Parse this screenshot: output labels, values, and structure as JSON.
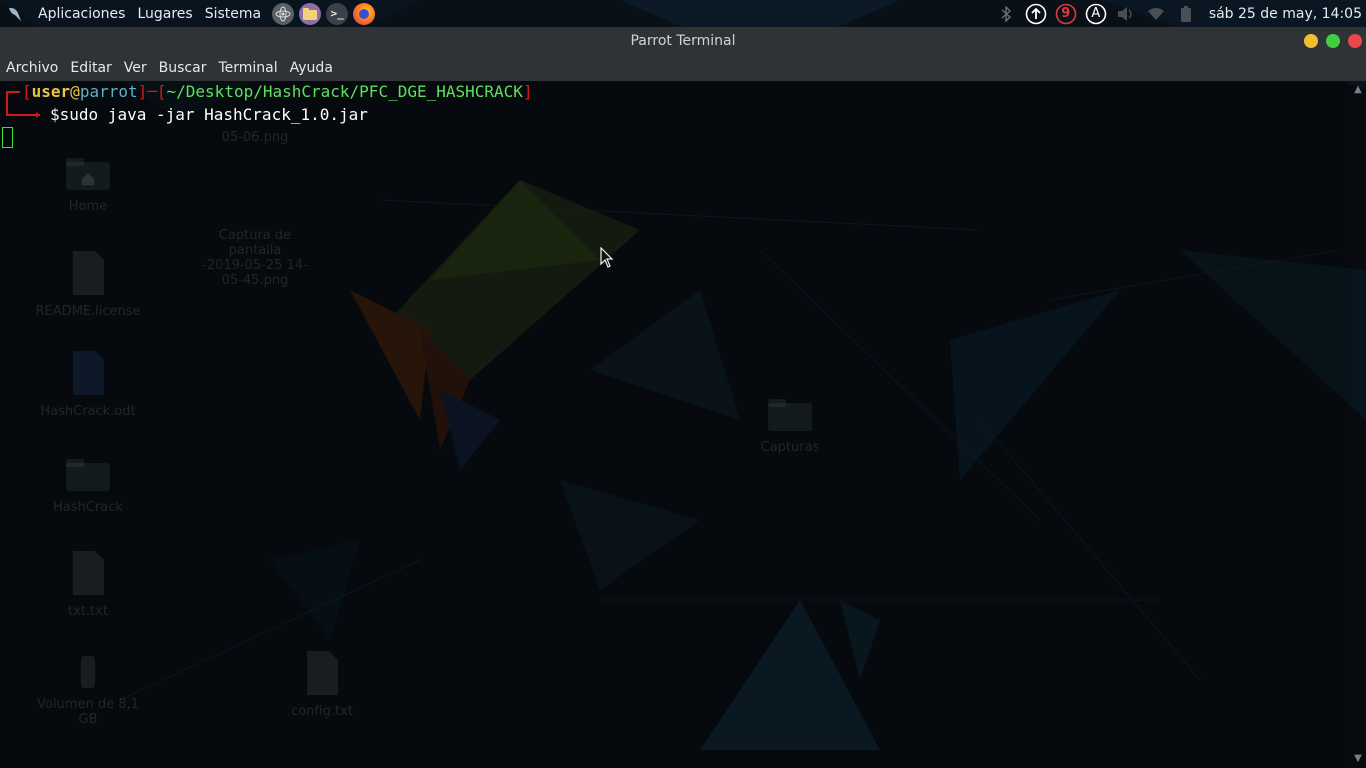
{
  "top_panel": {
    "menus": [
      "Aplicaciones",
      "Lugares",
      "Sistema"
    ],
    "launchers": [
      "atom-icon",
      "folder-icon",
      "terminal-icon",
      "firefox-icon"
    ],
    "tray": {
      "bluetooth_icon": "bluetooth-icon",
      "updates_icon": "arrow-up-circle-icon",
      "notifications_count": "9",
      "accessibility_label": "A",
      "clock": "sáb 25 de may, 14:05"
    }
  },
  "window": {
    "title": "Parrot Terminal",
    "menu": [
      "Archivo",
      "Editar",
      "Ver",
      "Buscar",
      "Terminal",
      "Ayuda"
    ]
  },
  "terminal": {
    "prompt": {
      "user": "user",
      "at": "@",
      "host": "parrot",
      "cwd": "~/Desktop/HashCrack/PFC_DGE_HASHCRACK",
      "symbol": "$"
    },
    "command": "sudo java -jar HashCrack_1.0.jar"
  },
  "desktop_icons": [
    {
      "label": "05-06.png",
      "icon": "image-icon"
    },
    {
      "label": "Home",
      "icon": "home-folder-icon"
    },
    {
      "label": "Captura de pantalla\n-2019-05-25 14-\n05-45.png",
      "icon": "image-icon"
    },
    {
      "label": "README.license",
      "icon": "text-file-icon"
    },
    {
      "label": "HashCrack.odt",
      "icon": "document-icon"
    },
    {
      "label": "HashCrack",
      "icon": "folder-icon"
    },
    {
      "label": "Capturas",
      "icon": "folder-icon"
    },
    {
      "label": "txt.txt",
      "icon": "text-file-icon"
    },
    {
      "label": "Volumen de 8,1 GB",
      "icon": "usb-drive-icon"
    },
    {
      "label": "config.txt",
      "icon": "text-file-icon"
    }
  ],
  "colors": {
    "prompt_frame": "#d11b1b",
    "user_host": "#e8c547",
    "path": "#5be25b",
    "close": "#e84848",
    "maximize": "#3fcf3f",
    "minimize": "#f0c030"
  }
}
